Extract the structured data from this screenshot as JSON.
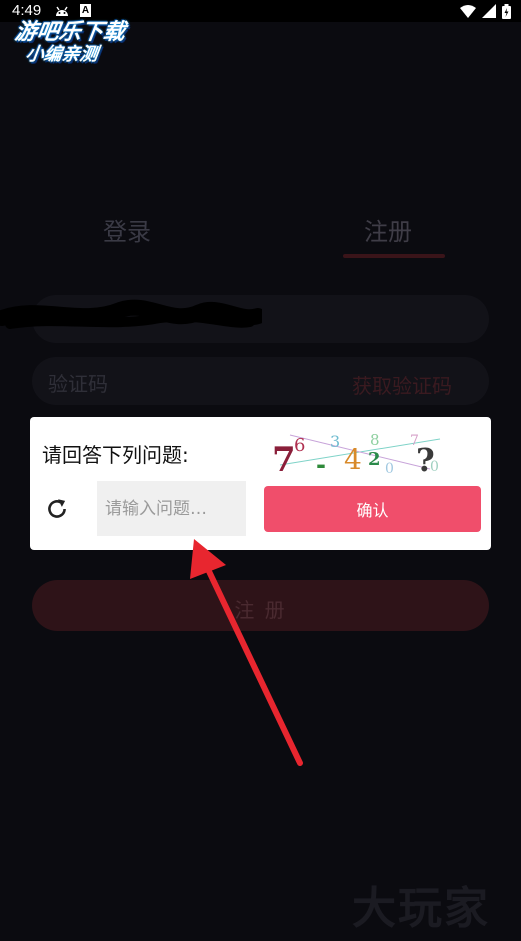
{
  "status_bar": {
    "time": "4:49",
    "notification_letter": "A"
  },
  "watermark_top": {
    "line1": "游吧乐下载",
    "line2": "小编亲测"
  },
  "tabs": {
    "login": "登录",
    "register": "注册"
  },
  "form": {
    "code_placeholder": "验证码",
    "get_code": "获取验证码",
    "register_button": "注 册"
  },
  "dialog": {
    "question": "请回答下列问题:",
    "answer_placeholder": "请输入问题…",
    "confirm": "确认",
    "captcha_glyphs": [
      "7",
      "6",
      "-",
      "4",
      "2",
      "?"
    ]
  },
  "watermark_bottom": "大玩家",
  "colors": {
    "accent": "#f04e6b",
    "background": "#0b0b10",
    "annotation_arrow": "#e8262f"
  }
}
